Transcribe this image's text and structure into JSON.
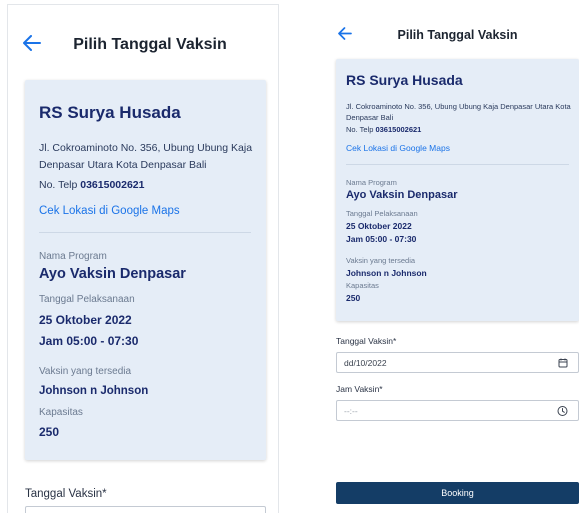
{
  "left": {
    "title": "Pilih Tanggal Vaksin",
    "hospital": {
      "name": "RS Surya Husada",
      "address": "Jl. Cokroaminoto No. 356, Ubung Ubung Kaja Denpasar Utara Kota Denpasar Bali",
      "phone_prefix": "No. Telp ",
      "phone": "03615002621",
      "maps_link": "Cek Lokasi di Google Maps"
    },
    "program": {
      "name_label": "Nama Program",
      "name": "Ayo Vaksin Denpasar",
      "date_label": "Tanggal Pelaksanaan",
      "date": "25 Oktober 2022",
      "time": "Jam 05:00 - 07:30",
      "vaccine_label": "Vaksin yang tersedia",
      "vaccine": "Johnson n Johnson",
      "capacity_label": "Kapasitas",
      "capacity": "250"
    },
    "date_field_label": "Tanggal Vaksin*"
  },
  "right": {
    "title": "Pilih Tanggal Vaksin",
    "hospital": {
      "name": "RS Surya Husada",
      "address": "Jl. Cokroaminoto No. 356, Ubung Ubung Kaja Denpasar Utara Kota Denpasar Bali",
      "phone_prefix": "No. Telp ",
      "phone": "03615002621",
      "maps_link": "Cek Lokasi di Google Maps"
    },
    "program": {
      "name_label": "Nama Program",
      "name": "Ayo Vaksin Denpasar",
      "date_label": "Tanggal Pelaksanaan",
      "date": "25 Oktober 2022",
      "time": "Jam 05:00 - 07:30",
      "vaccine_label": "Vaksin yang tersedia",
      "vaccine": "Johnson n Johnson",
      "capacity_label": "Kapasitas",
      "capacity": "250"
    },
    "date_field": {
      "label": "Tanggal Vaksin*",
      "value": "dd/10/2022"
    },
    "time_field": {
      "label": "Jam Vaksin*",
      "value": "--:--"
    },
    "booking_button": "Booking"
  },
  "colors": {
    "accent": "#1a73e8",
    "card_bg": "#e5edf7",
    "heading": "#1a2a6c",
    "button_bg": "#143d66"
  },
  "icons": {
    "back": "arrow-left-icon",
    "date": "calendar-icon",
    "time": "clock-icon"
  }
}
